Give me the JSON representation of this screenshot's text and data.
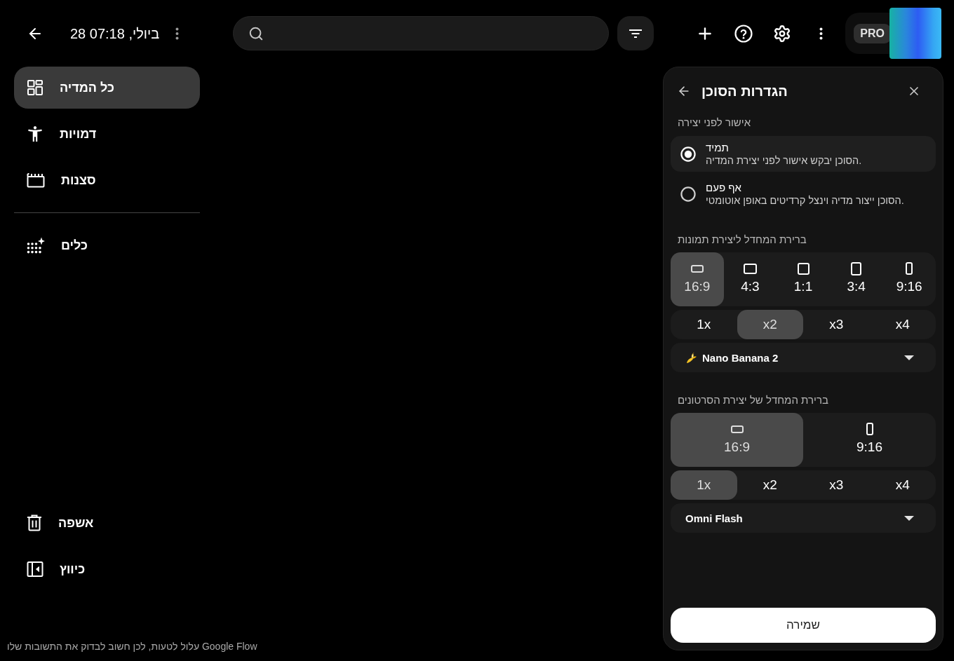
{
  "header": {
    "title": "28 ביולי, 07:18"
  },
  "account": {
    "plan_badge": "PRO"
  },
  "sidebar": {
    "items": [
      {
        "label": "כל המדיה",
        "selected": true
      },
      {
        "label": "דמויות",
        "selected": false
      },
      {
        "label": "סצנות",
        "selected": false
      }
    ],
    "tools": [
      {
        "label": "כלים",
        "selected": false
      }
    ],
    "bottom_items": [
      {
        "label": "אשפה"
      },
      {
        "label": "כיווץ"
      }
    ]
  },
  "settings_panel": {
    "title": "הגדרות הסוכן",
    "approval": {
      "label": "אישור לפני יצירה",
      "options": [
        {
          "title": "תמיד",
          "description": "הסוכן יבקש אישור לפני יצירת המדיה.",
          "selected": true
        },
        {
          "title": "אף פעם",
          "description": "הסוכן ייצור מדיה וינצל קרדיטים באופן אוטומטי.",
          "selected": false
        }
      ]
    },
    "image_defaults": {
      "label": "ברירת המחדל ליצירת תמונות",
      "aspect_ratios": [
        {
          "label": "9:16",
          "kind": "tall",
          "selected": false
        },
        {
          "label": "3:4",
          "kind": "portrait",
          "selected": false
        },
        {
          "label": "1:1",
          "kind": "square",
          "selected": false
        },
        {
          "label": "4:3",
          "kind": "landscape",
          "selected": false
        },
        {
          "label": "16:9",
          "kind": "wide",
          "selected": true
        }
      ],
      "counts": [
        {
          "label": "x4",
          "selected": false
        },
        {
          "label": "x3",
          "selected": false
        },
        {
          "label": "x2",
          "selected": true
        },
        {
          "label": "1x",
          "selected": false
        }
      ],
      "model": {
        "value": "Nano Banana 2",
        "kind": "banana"
      }
    },
    "video_defaults": {
      "label": "ברירת המחדל של יצירת הסרטונים",
      "aspect_ratios": [
        {
          "label": "9:16",
          "kind": "tall",
          "selected": false
        },
        {
          "label": "16:9",
          "kind": "wide",
          "selected": true
        }
      ],
      "counts": [
        {
          "label": "x4",
          "selected": false
        },
        {
          "label": "x3",
          "selected": false
        },
        {
          "label": "x2",
          "selected": false
        },
        {
          "label": "1x",
          "selected": true
        }
      ],
      "model": {
        "value": "Omni Flash"
      }
    },
    "save_button": "שמירה"
  },
  "footer": {
    "disclaimer": "Google Flow עלול לטעות, לכן חשוב לבדוק את התשובות שלו"
  }
}
